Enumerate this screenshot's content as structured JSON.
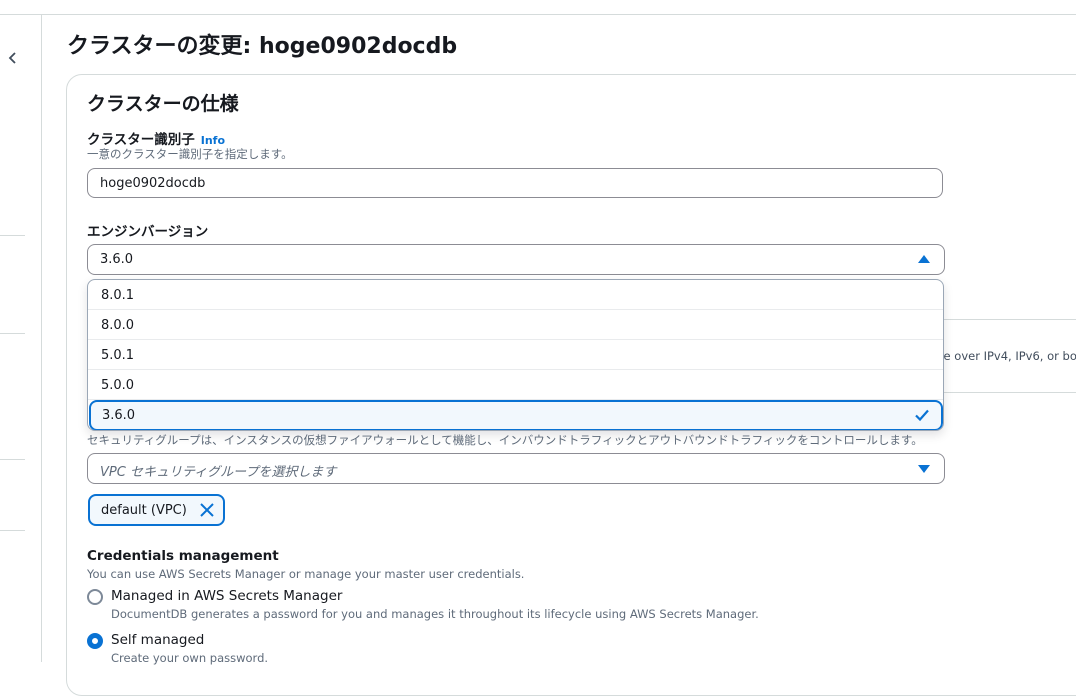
{
  "page": {
    "title": "クラスターの変更: hoge0902docdb"
  },
  "section": {
    "title": "クラスターの仕様"
  },
  "cluster_identifier": {
    "label": "クラスター識別子",
    "info_link": "Info",
    "description": "一意のクラスター識別子を指定します。",
    "value": "hoge0902docdb"
  },
  "engine_version": {
    "label": "エンジンバージョン",
    "selected": "3.6.0",
    "options": [
      "8.0.1",
      "8.0.0",
      "5.0.1",
      "5.0.0",
      "3.6.0"
    ]
  },
  "background_fragment": {
    "text": "ate over IPv4, IPv6, or bo"
  },
  "security_groups": {
    "description": "セキュリティグループは、インスタンスの仮想ファイアウォールとして機能し、インバウンドトラフィックとアウトバウンドトラフィックをコントロールします。",
    "placeholder": "VPC セキュリティグループを選択します",
    "tokens": [
      "default (VPC)"
    ]
  },
  "credentials": {
    "label": "Credentials management",
    "description": "You can use AWS Secrets Manager or manage your master user credentials.",
    "options": [
      {
        "label": "Managed in AWS Secrets Manager",
        "description": "DocumentDB generates a password for you and manages it throughout its lifecycle using AWS Secrets Manager.",
        "selected": false
      },
      {
        "label": "Self managed",
        "description": "Create your own password.",
        "selected": true
      }
    ]
  },
  "colors": {
    "accent": "#0972d3",
    "text": "#16191f",
    "muted": "#5f6b7a",
    "border": "#8c8c94"
  },
  "icons": {
    "nav_toggle": "chevron-left-icon",
    "select_open": "caret-up-icon",
    "select_closed": "caret-down-icon",
    "selected_check": "check-icon",
    "token_remove": "close-icon"
  }
}
